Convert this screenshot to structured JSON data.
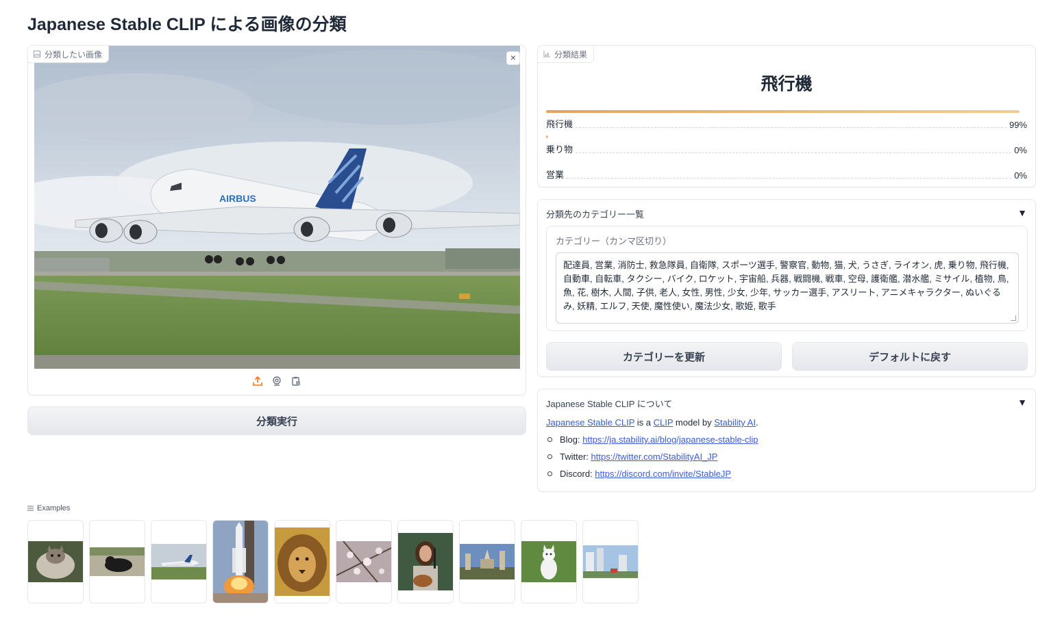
{
  "page": {
    "title": "Japanese Stable CLIP による画像の分類"
  },
  "image_input": {
    "label": "分類したい画像",
    "clear_label": "×"
  },
  "run_button": {
    "label": "分類実行"
  },
  "result": {
    "label": "分類結果",
    "top_label": "飛行機",
    "confidences": [
      {
        "label": "飛行機",
        "percent": "99%",
        "value": 0.99
      },
      {
        "label": "乗り物",
        "percent": "0%",
        "value": 0.004
      },
      {
        "label": "営業",
        "percent": "0%",
        "value": 0.0
      }
    ]
  },
  "categories": {
    "accordion_title": "分類先のカテゴリー一覧",
    "textbox_label": "カテゴリー（カンマ区切り）",
    "textbox_value": "配達員, 営業, 消防士, 救急隊員, 自衛隊, スポーツ選手, 警察官, 動物, 猫, 犬, うさぎ, ライオン, 虎, 乗り物, 飛行機, 自動車, 自転車, タクシー, バイク, ロケット, 宇宙船, 兵器, 戦闘機, 戦車, 空母, 護衛艦, 潜水艦, ミサイル, 植物, 鳥, 魚, 花, 樹木, 人間, 子供, 老人, 女性, 男性, 少女, 少年, サッカー選手, アスリート, アニメキャラクター, ぬいぐるみ, 妖精, エルフ, 天使, 魔性使い, 魔法少女, 歌姫, 歌手",
    "update_button": "カテゴリーを更新",
    "reset_button": "デフォルトに戻す"
  },
  "about": {
    "accordion_title": "Japanese Stable CLIP について",
    "link_model": "Japanese Stable CLIP",
    "text_is_a": " is a ",
    "link_clip": "CLIP",
    "text_model_by": " model by ",
    "link_stability": "Stability AI",
    "text_period": ".",
    "items": [
      {
        "prefix": "Blog: ",
        "link": "https://ja.stability.ai/blog/japanese-stable-clip"
      },
      {
        "prefix": "Twitter: ",
        "link": "https://twitter.com/StabilityAI_JP"
      },
      {
        "prefix": "Discord: ",
        "link": "https://discord.com/invite/StableJP"
      }
    ]
  },
  "examples": {
    "label": "Examples",
    "items": [
      "cat-1",
      "cat-2",
      "airplane",
      "rocket",
      "lion",
      "blossoms",
      "singer",
      "monument",
      "dog",
      "city"
    ]
  },
  "colors": {
    "accent": "#f97316",
    "bar_start": "#e8a25b",
    "bar_end": "#f6cc8b",
    "link": "#3b5bdb"
  }
}
